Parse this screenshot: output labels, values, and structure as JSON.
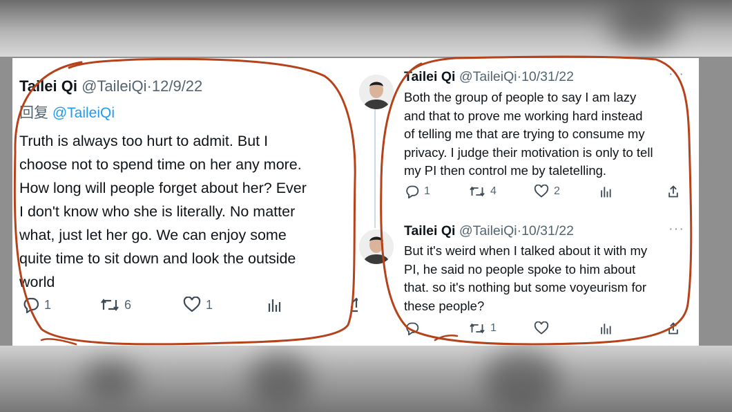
{
  "left_tweet": {
    "name": "Tailei Qi",
    "handle": "@TaileiQi",
    "date": "12/9/22",
    "reply_label": "回复",
    "reply_handle": "@TaileiQi",
    "lines": [
      "Truth is always too hurt to admit. But I",
      "choose not to spend time on her any more.",
      "How long will people forget about her? Ever",
      "I don't know who she is literally. No matter",
      "what, just let her go. We can enjoy some",
      "quite time to sit down and look the outside",
      "world"
    ],
    "reply_count": "1",
    "retweet_count": "6",
    "like_count": "1"
  },
  "right_tweets": [
    {
      "name": "Tailei Qi",
      "handle": "@TaileiQi",
      "date": "10/31/22",
      "lines": [
        "Both the group of people to say I am lazy",
        "and that to prove me working hard instead",
        "of telling me that are trying to consume my",
        "privacy. I judge their motivation is only to tell",
        "my PI then control me by taletelling."
      ],
      "reply_count": "1",
      "retweet_count": "4",
      "like_count": "2"
    },
    {
      "name": "Tailei Qi",
      "handle": "@TaileiQi",
      "date": "10/31/22",
      "lines": [
        "But it's weird when I talked about it with my",
        "PI, he said no people spoke to him about",
        "that. so it's nothing but some voyeurism for",
        "these people?"
      ],
      "reply_count": "",
      "retweet_count": "1",
      "like_count": ""
    }
  ],
  "colors": {
    "annotation": "#b5421a",
    "text": "#0f1419",
    "secondary": "#536471",
    "link": "#1d9bf0"
  }
}
